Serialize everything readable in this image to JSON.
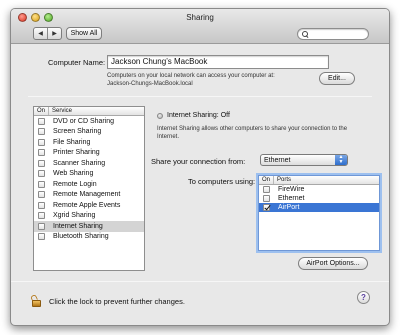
{
  "window": {
    "title": "Sharing"
  },
  "toolbar": {
    "back_icon": "◀",
    "forward_icon": "▶",
    "show_all_label": "Show All",
    "search_placeholder": ""
  },
  "computer": {
    "label": "Computer Name:",
    "value": "Jackson Chung’s MacBook",
    "note_line1": "Computers on your local network can access your computer at:",
    "note_line2": "Jackson-Chungs-MacBook.local",
    "edit_label": "Edit..."
  },
  "services": {
    "header_on": "On",
    "header_service": "Service",
    "items": [
      {
        "label": "DVD or CD Sharing",
        "checked": false
      },
      {
        "label": "Screen Sharing",
        "checked": false
      },
      {
        "label": "File Sharing",
        "checked": false
      },
      {
        "label": "Printer Sharing",
        "checked": false
      },
      {
        "label": "Scanner Sharing",
        "checked": false
      },
      {
        "label": "Web Sharing",
        "checked": false
      },
      {
        "label": "Remote Login",
        "checked": false
      },
      {
        "label": "Remote Management",
        "checked": false
      },
      {
        "label": "Remote Apple Events",
        "checked": false
      },
      {
        "label": "Xgrid Sharing",
        "checked": false
      },
      {
        "label": "Internet Sharing",
        "checked": false,
        "selected": true
      },
      {
        "label": "Bluetooth Sharing",
        "checked": false
      }
    ]
  },
  "detail": {
    "status": "Internet Sharing: Off",
    "description_line1": "Internet Sharing allows other computers to share your connection to the",
    "description_line2": "Internet.",
    "share_from_label": "Share your connection from:",
    "share_from_value": "Ethernet",
    "to_computers_label": "To computers using:",
    "ports_header_on": "On",
    "ports_header_ports": "Ports",
    "ports": [
      {
        "label": "FireWire",
        "checked": false
      },
      {
        "label": "Ethernet",
        "checked": false
      },
      {
        "label": "AirPort",
        "checked": true,
        "selected": true
      }
    ],
    "airport_options_label": "AirPort Options..."
  },
  "footer": {
    "lock_text": "Click the lock to prevent further changes.",
    "help_label": "?"
  },
  "colors": {
    "selection": "#3a75d4",
    "window_bg": "#e8e8e8"
  }
}
